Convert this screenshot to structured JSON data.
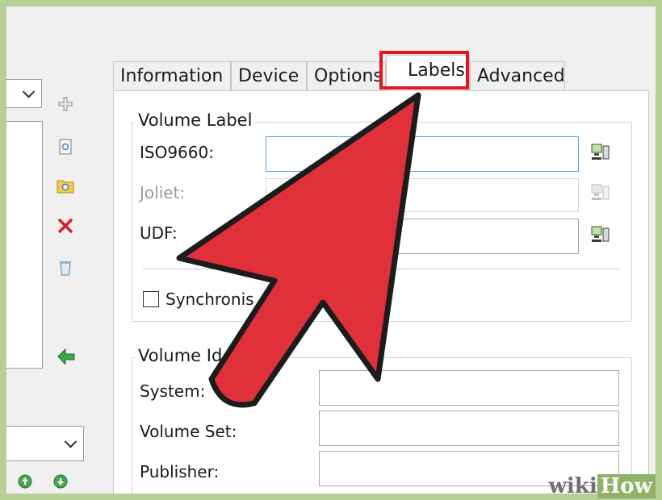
{
  "tabs": [
    {
      "label": "Information"
    },
    {
      "label": "Device"
    },
    {
      "label": "Options"
    },
    {
      "label": "Labels"
    },
    {
      "label": "Advanced"
    }
  ],
  "selected_tab": "Labels",
  "volume_label": {
    "title": "Volume Label",
    "iso9660": "ISO9660:",
    "joliet": "Joliet:",
    "udf": "UDF:",
    "synchronise": "Synchronis"
  },
  "volume_identifiers": {
    "title": "Volume Id",
    "system": "System:",
    "volume_set": "Volume Set:",
    "publisher": "Publisher:"
  },
  "icons": {
    "add": "plus-icon",
    "view": "view-file-icon",
    "search": "folder-search-icon",
    "delete": "red-x-icon",
    "recycle": "recycle-bin-icon",
    "burn": "green-arrow-icon",
    "pc": "computer-icon",
    "move_up": "move-up-icon",
    "move_down": "move-down-icon"
  },
  "colors": {
    "highlight": "#e3141b",
    "arrow": "#e0303a",
    "border": "#b5cf94"
  },
  "watermark": {
    "part1": "wiki",
    "part2": "How"
  }
}
